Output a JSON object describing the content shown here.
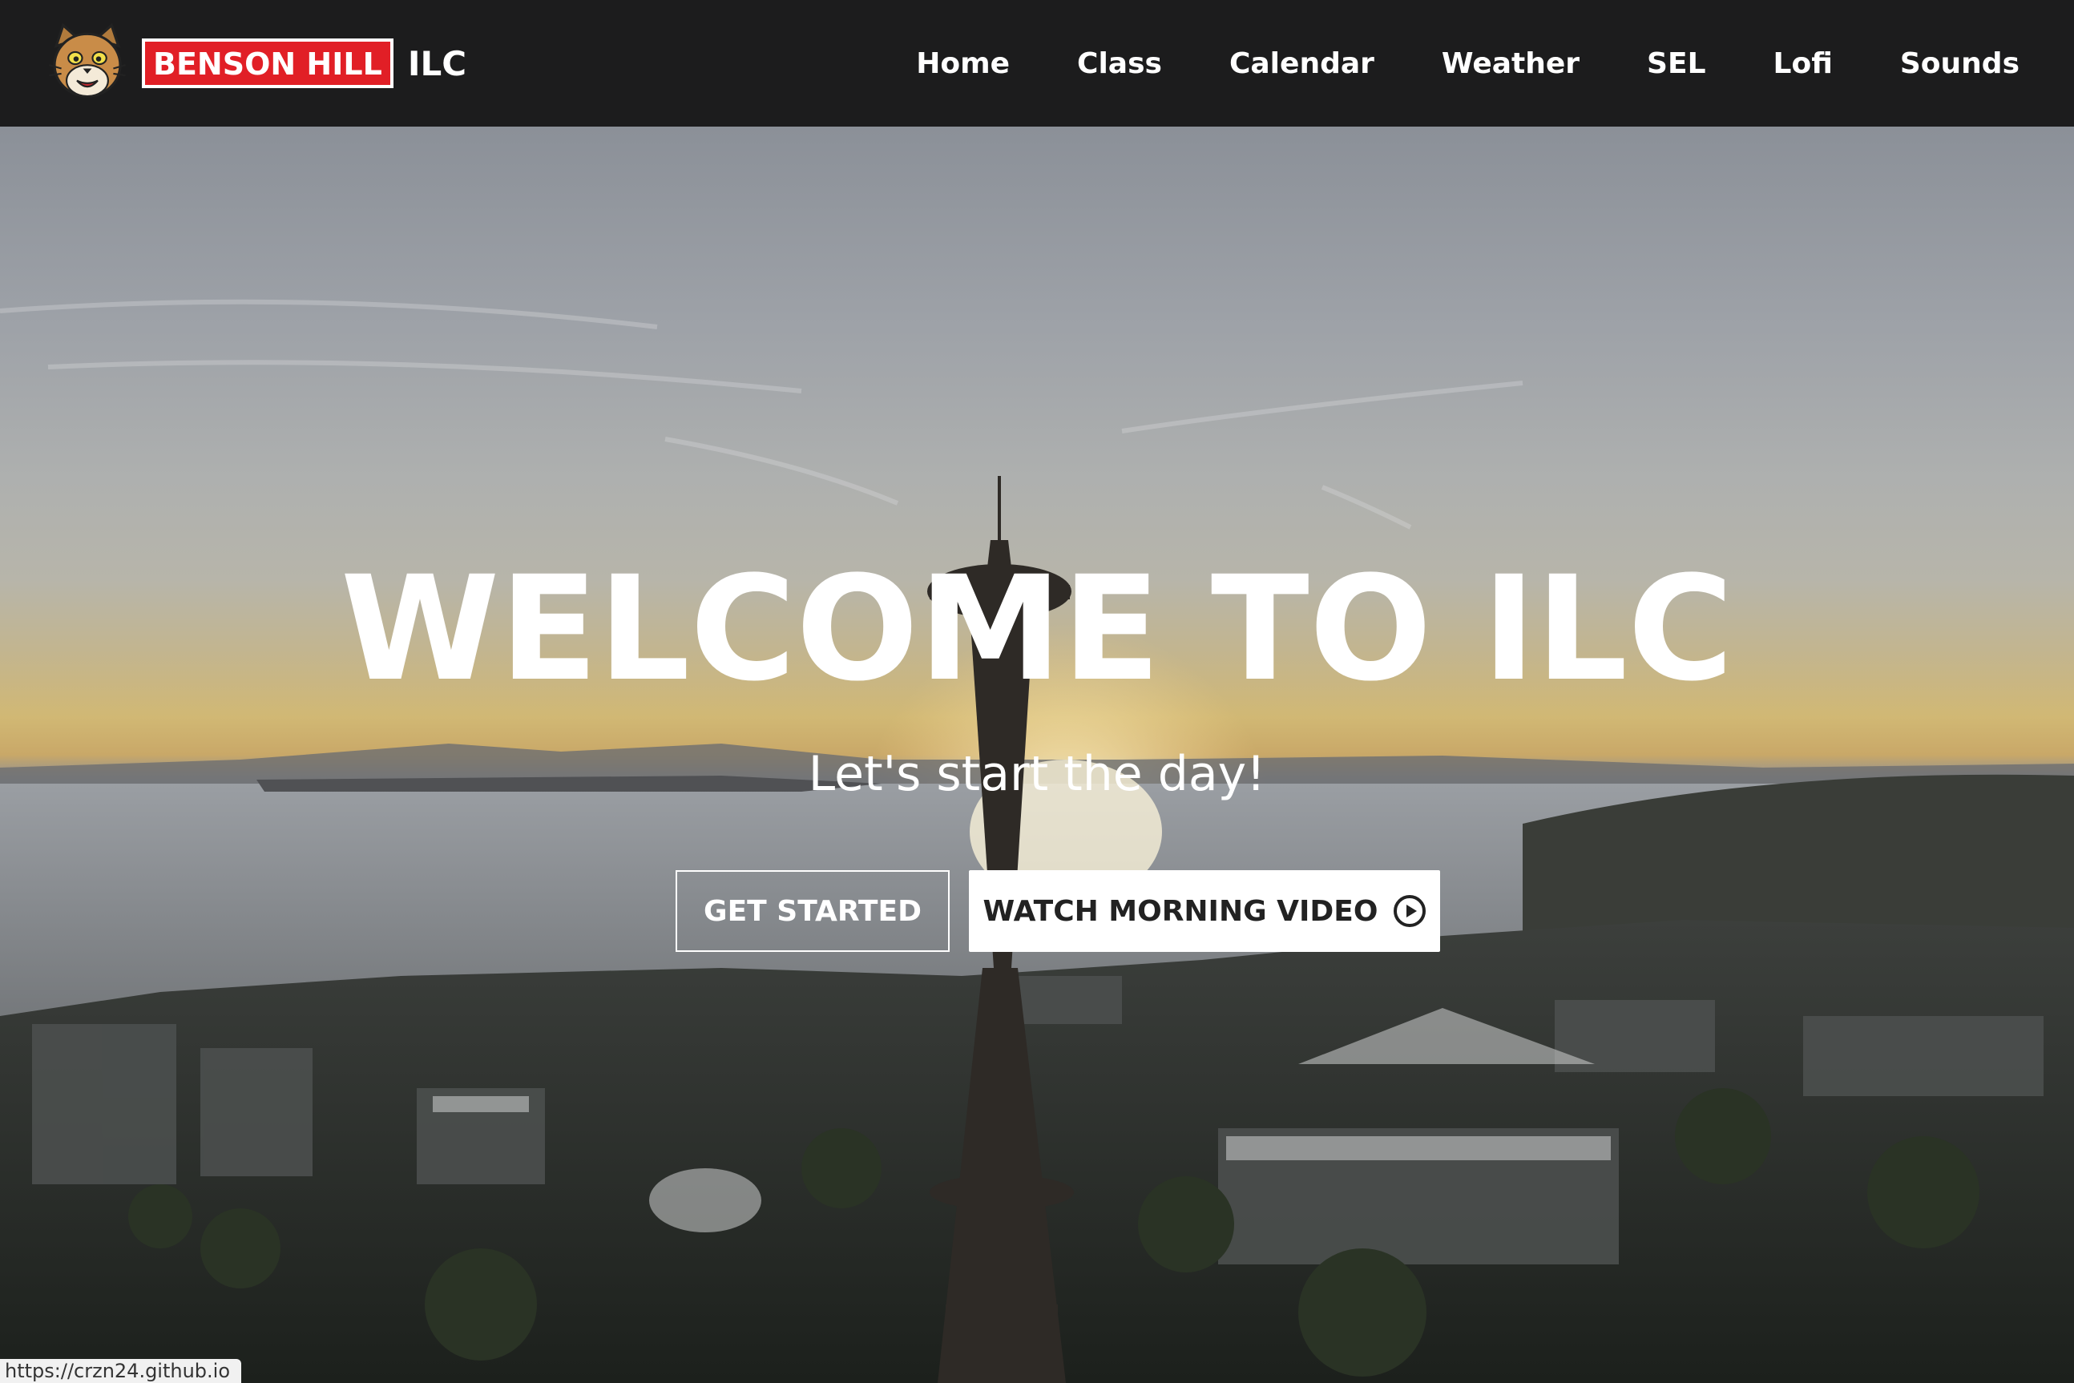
{
  "header": {
    "logo_badge": "BENSON HILL",
    "logo_suffix": "ILC",
    "nav": [
      "Home",
      "Class",
      "Calendar",
      "Weather",
      "SEL",
      "Lofi",
      "Sounds"
    ]
  },
  "hero": {
    "title": "WELCOME TO ILC",
    "subtitle": "Let's start the day!",
    "primary_button": "GET STARTED",
    "secondary_button": "WATCH MORNING VIDEO",
    "secondary_icon": "play-circle-icon"
  },
  "status_bar": {
    "url": "https://crzn24.github.io"
  },
  "colors": {
    "header_bg": "#1c1c1d",
    "badge_red": "#e11f26",
    "text": "#ffffff"
  }
}
